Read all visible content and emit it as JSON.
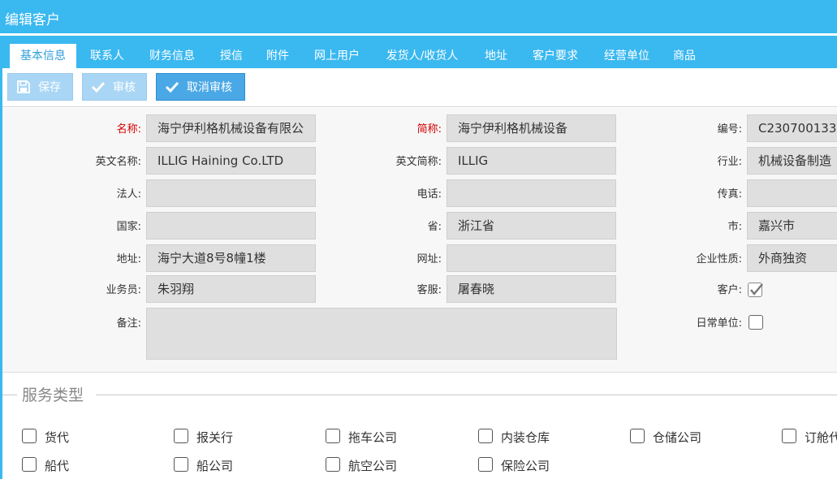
{
  "window": {
    "title": "编辑客户"
  },
  "tabs": [
    "基本信息",
    "联系人",
    "财务信息",
    "授信",
    "附件",
    "网上用户",
    "发货人/收货人",
    "地址",
    "客户要求",
    "经营单位",
    "商品"
  ],
  "toolbar": {
    "save": "保存",
    "approve": "审核",
    "cancel_approve": "取消审核"
  },
  "form": {
    "name_label": "名称:",
    "name": "海宁伊利格机械设备有限公",
    "short_label": "简称:",
    "short": "海宁伊利格机械设备",
    "code_label": "编号:",
    "code": "C230700133",
    "en_name_label": "英文名称:",
    "en_name": "ILLIG Haining Co.LTD",
    "en_short_label": "英文简称:",
    "en_short": "ILLIG",
    "industry_label": "行业:",
    "industry": "机械设备制造",
    "legal_label": "法人:",
    "legal": "",
    "phone_label": "电话:",
    "phone": "",
    "fax_label": "传真:",
    "fax": "",
    "country_label": "国家:",
    "country": "",
    "province_label": "省:",
    "province": "浙江省",
    "city_label": "市:",
    "city": "嘉兴市",
    "address_label": "地址:",
    "address": "海宁大道8号8幢1楼",
    "website_label": "网址:",
    "website": "",
    "nature_label": "企业性质:",
    "nature": "外商独资",
    "sales_label": "业务员:",
    "sales": "朱羽翔",
    "service_label": "客服:",
    "service": "屠春晓",
    "customer_label": "客户:",
    "customer_checked": true,
    "remark_label": "备注:",
    "remark": "",
    "daily_label": "日常单位:",
    "daily_checked": false
  },
  "service_types": {
    "legend": "服务类型",
    "items": [
      "货代",
      "报关行",
      "拖车公司",
      "内装仓库",
      "仓储公司",
      "订舱代",
      "船代",
      "船公司",
      "航空公司",
      "保险公司"
    ]
  },
  "colors": {
    "accent": "#3ab8f0",
    "button": "#4aa8e6",
    "button_disabled": "#a9d6f5",
    "required": "#d40000"
  }
}
